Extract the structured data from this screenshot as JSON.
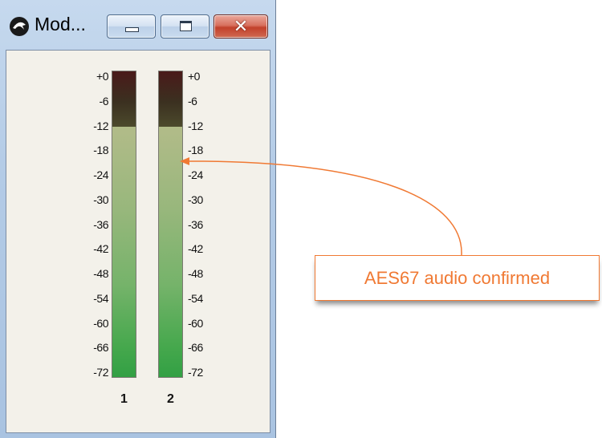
{
  "window": {
    "title": "Mod...",
    "buttons": {
      "minimize": "minimize",
      "maximize": "maximize",
      "close": "close"
    }
  },
  "meter": {
    "scale": [
      "+0",
      "-6",
      "-12",
      "-18",
      "-24",
      "-30",
      "-36",
      "-42",
      "-48",
      "-54",
      "-60",
      "-66",
      "-72"
    ],
    "channels": [
      {
        "label": "1",
        "level_db": -12
      },
      {
        "label": "2",
        "level_db": -12
      }
    ],
    "colors": {
      "peak": "#3b3020",
      "low": "#32a044",
      "mid": "#b0bb88"
    }
  },
  "annotation": {
    "text": "AES67 audio confirmed",
    "color": "#f07933"
  }
}
